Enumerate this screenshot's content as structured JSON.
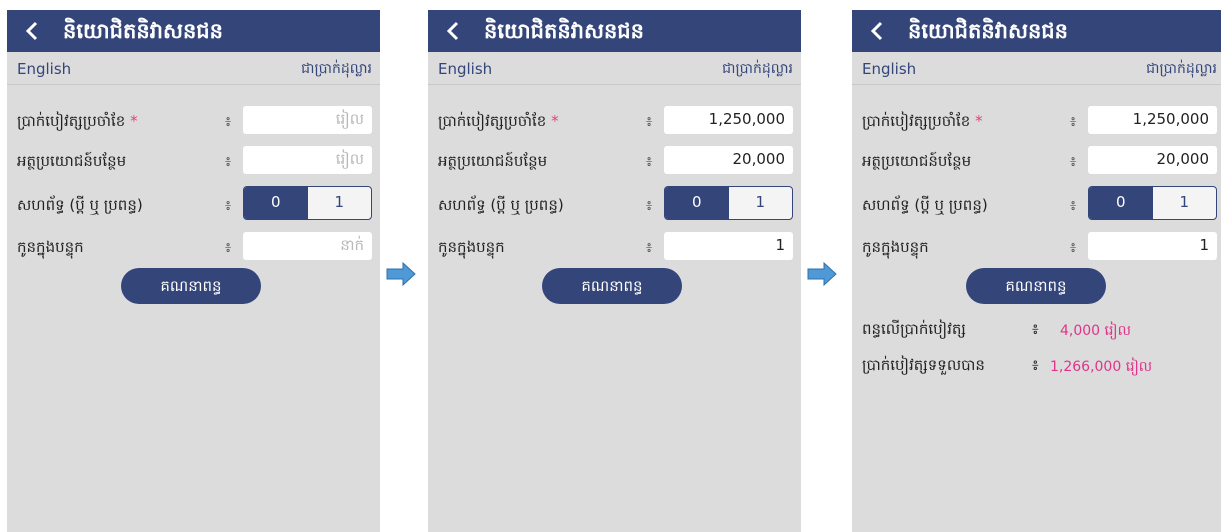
{
  "app": {
    "title": "និយោជិតនិវាសនជន",
    "language_link": "English",
    "currency_label": "ជាប្រាក់ដុល្លារ"
  },
  "form": {
    "salary_label": "ប្រាក់បៀវត្សប្រចាំខែ",
    "required_mark": "*",
    "fringe_label": "អត្ថប្រយោជន៍បន្ថែម",
    "spouse_label": "សហព័ទ្ធ (ប្ដី ឬ ប្រពន្ធ)",
    "children_label": "កូនក្នុងបន្ទុក",
    "colon": "៖",
    "riel_placeholder": "រៀល",
    "person_placeholder": "នាក់",
    "spouse_options": [
      "0",
      "1"
    ],
    "calculate_button": "គណនាពន្ធ"
  },
  "screens": [
    {
      "salary": "",
      "fringe": "",
      "spouse_selected": "0",
      "children": ""
    },
    {
      "salary": "1,250,000",
      "fringe": "20,000",
      "spouse_selected": "0",
      "children": "1"
    },
    {
      "salary": "1,250,000",
      "fringe": "20,000",
      "spouse_selected": "0",
      "children": "1"
    }
  ],
  "results": {
    "tax_label": "ពន្ធលើប្រាក់បៀវត្ស",
    "tax_value": "4,000 រៀល",
    "net_label": "ប្រាក់បៀវត្សទទួលបាន",
    "net_value": "1,266,000 រៀល"
  },
  "colors": {
    "header": "#34457a",
    "accent_result": "#e0338a",
    "arrow": "#4f9ad6"
  }
}
